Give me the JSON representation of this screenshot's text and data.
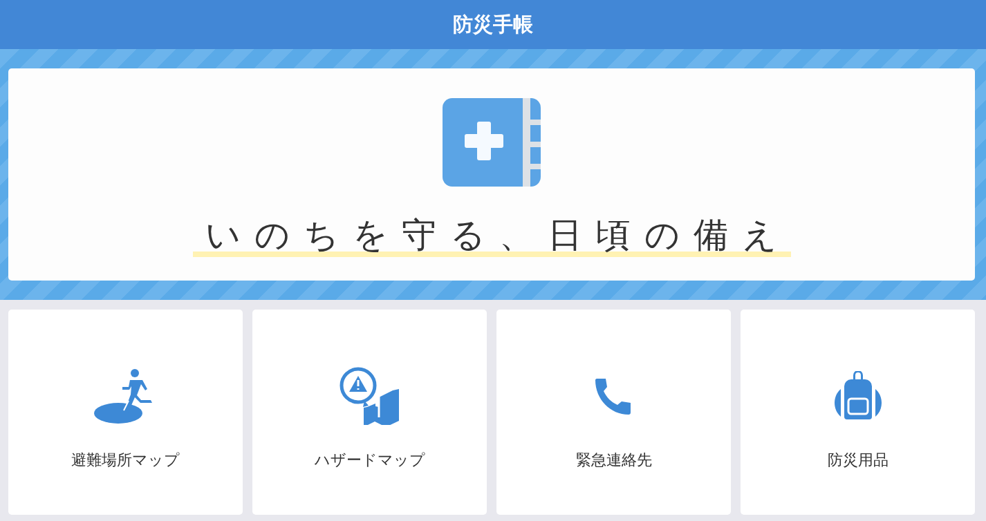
{
  "header": {
    "title": "防災手帳"
  },
  "hero": {
    "tagline": "いのちを守る、日頃の備え"
  },
  "tiles": [
    {
      "kind": "evacuation",
      "label": "避難場所マップ"
    },
    {
      "kind": "hazard",
      "label": "ハザードマップ"
    },
    {
      "kind": "phone",
      "label": "緊急連絡先"
    },
    {
      "kind": "backpack",
      "label": "防災用品"
    }
  ]
}
